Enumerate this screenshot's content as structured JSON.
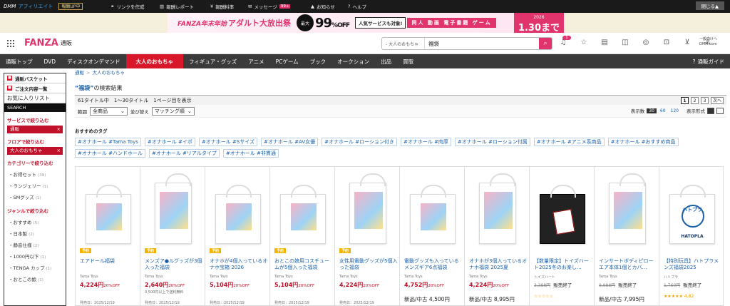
{
  "topbar": {
    "logo": "DMM",
    "logo_sub": "アフィリエイト",
    "rankup": "報酬UP中",
    "links": [
      {
        "label": "リンクを作成",
        "icon": "link-icon",
        "sym": "🔗"
      },
      {
        "label": "報酬レポート",
        "icon": "chart-icon",
        "sym": "▥"
      },
      {
        "label": "報酬料率",
        "icon": "yen-icon",
        "sym": "¥"
      },
      {
        "label": "メッセージ",
        "icon": "mail-icon",
        "sym": "✉",
        "badge": "99+"
      },
      {
        "label": "お知らせ",
        "icon": "bell-icon",
        "sym": "🔔"
      },
      {
        "label": "ヘルプ",
        "icon": "help-icon",
        "sym": "?"
      }
    ],
    "close_label": "閉じる▲"
  },
  "banner": {
    "brand": "FANZA年末年始",
    "title": "アダルト大放出祭",
    "max_label": "最大",
    "percent": "99",
    "off": "%OFF",
    "all_label": "人気サービスも対象!",
    "cats": "同人 動画 電子書籍 ゲーム",
    "year": "2026",
    "until": "1.30まで"
  },
  "header": {
    "logo_a": "FANZA",
    "logo_b": "通販",
    "search_category": "- 大人のおもちゃ ",
    "search_query": "福袋",
    "icons": [
      "bell-icon",
      "star-icon",
      "cart-history-icon",
      "chat-icon",
      "point-icon",
      "lock-icon",
      "cart-icon",
      "user-icon"
    ],
    "notif_count": "1",
    "account_line1": "一般向けへ",
    "account_line2": "DMM.com"
  },
  "nav": {
    "items": [
      "通販トップ",
      "DVD",
      "ディスクオンデマンド",
      "大人のおもちゃ",
      "フィギュア・グッズ",
      "アニメ",
      "PCゲーム",
      "ブック",
      "オークション",
      "出品",
      "買取"
    ],
    "active_index": 3,
    "guide": "通販ガイド"
  },
  "side": {
    "basket": "通販バスケット",
    "history": "ご注文内容一覧",
    "fav": "お気に入りリスト",
    "search_head": "SEARCH",
    "service_title": "サービスで絞り込む",
    "service_sel": "通販",
    "floor_title": "フロアで絞り込む",
    "floor_sel": "大人のおもちゃ",
    "cat_title": "カテゴリーで絞り込む",
    "cats": [
      {
        "label": "お得セット",
        "count": "(39)"
      },
      {
        "label": "ランジェリー",
        "count": "(1)"
      },
      {
        "label": "SMグッズ",
        "count": "(1)"
      }
    ],
    "genre_title": "ジャンルで絞り込む",
    "genres": [
      {
        "label": "おすすめ",
        "count": "(5)"
      },
      {
        "label": "日本製",
        "count": "(2)"
      },
      {
        "label": "静音仕様",
        "count": "(2)"
      },
      {
        "label": "1000円以下",
        "count": "(1)"
      },
      {
        "label": "TENGA カップ",
        "count": "(1)"
      },
      {
        "label": "おとこの娘",
        "count": "(1)"
      }
    ]
  },
  "main": {
    "bread_1": "通販",
    "bread_sep": ">",
    "bread_2": "大人のおもちゃ",
    "query_quote": "“福袋”",
    "query_suffix": "の検索結果",
    "result_info": "61タイトル中　1～30タイトル　1ページ目を表示",
    "pages": [
      "1",
      "2",
      "3",
      "次へ"
    ],
    "range_label": "範囲",
    "range_value": "全商品",
    "sort_label": "並び替え",
    "sort_value": "マッチング順",
    "per_page_label": "表示数",
    "per_page": [
      "30",
      "60",
      "120"
    ],
    "view_label": "表示形式",
    "tags_title": "おすすめのタグ",
    "tags": [
      "#オナホール #Tama Toys",
      "#オナホール #イボ",
      "#オナホール #Sサイズ",
      "#オナホール #AV女優",
      "#オナホール #ローション付き",
      "#オナホール #肉厚",
      "#オナホール #ローション付属",
      "#オナホール #アニメ系商品",
      "#オナホール #おすすめ商品",
      "#オナホール #ハンドホール",
      "#オナホール #リアルタイプ",
      "#オナホール #非貫通"
    ]
  },
  "products": [
    {
      "pre": "予約",
      "name": "エアドール福袋",
      "maker": "Tama Toys",
      "price": "4,224円",
      "off": "20%OFF",
      "extra": "",
      "date": "発売日：2025/12/19",
      "bag": "normal"
    },
    {
      "pre": "予約",
      "name": "メンズア●ルグッズが3個入った福袋",
      "maker": "Tama Toys",
      "price": "2,640円",
      "off": "20%OFF",
      "extra": "3,500円以上で送料無料",
      "date": "発売日：2025/12/19",
      "bag": "tall"
    },
    {
      "pre": "予約",
      "name": "オナホが4個入っているオナホ宝箱 2026",
      "maker": "Tama Toys",
      "price": "5,104円",
      "off": "20%OFF",
      "extra": "",
      "date": "発売日：2025/12/19",
      "bag": "normal"
    },
    {
      "pre": "予約",
      "name": "おとこの娘用コスチュームが5個入った福袋",
      "maker": "Tama Toys",
      "price": "5,104円",
      "off": "20%OFF",
      "extra": "",
      "date": "発売日：2025/12/19",
      "bag": "normal"
    },
    {
      "pre": "予約",
      "name": "女性用電動グッズが5個入った福袋",
      "maker": "Tama Toys",
      "price": "4,224円",
      "off": "20%OFF",
      "extra": "",
      "date": "発売日：2025/12/19",
      "bag": "tall"
    },
    {
      "pre": "",
      "name": "電動グッズも入っているメンズギア6点福袋",
      "maker": "Tama Toys",
      "price": "4,752円",
      "off": "20%OFF",
      "extra": "新品/中古 4,500円",
      "date": "",
      "bag": "normal"
    },
    {
      "pre": "",
      "name": "オナホが3個入っているオナホ福袋 2025夏",
      "maker": "Tama Toys",
      "price": "4,224円",
      "off": "20%OFF",
      "extra": "新品/中古 8,995円",
      "date": "",
      "bag": "tall"
    },
    {
      "pre": "",
      "name": "【数量限定】トイズハート2025冬のお楽し…",
      "maker": "トイズハート",
      "price": "3,388円",
      "off": "販売終了",
      "extra": "",
      "date": "☆☆☆☆☆",
      "bag": "black"
    },
    {
      "pre": "",
      "name": "インサートボディピローエア本体1個とカバ…",
      "maker": "Tama Toys",
      "price": "9,988円",
      "off": "販売終了",
      "extra": "新品/中古 7,995円",
      "date": "",
      "bag": "tall"
    },
    {
      "pre": "",
      "name": "【特別玩具】ハトプラメンズ福袋2025",
      "maker": "ハトプラ",
      "price": "1,760円",
      "off": "販売終了",
      "extra": "",
      "date": "★★★★★ 4.82",
      "bag": "hp",
      "logo_text": "HATOPLA",
      "logo_mark": "ハトプラ"
    }
  ]
}
